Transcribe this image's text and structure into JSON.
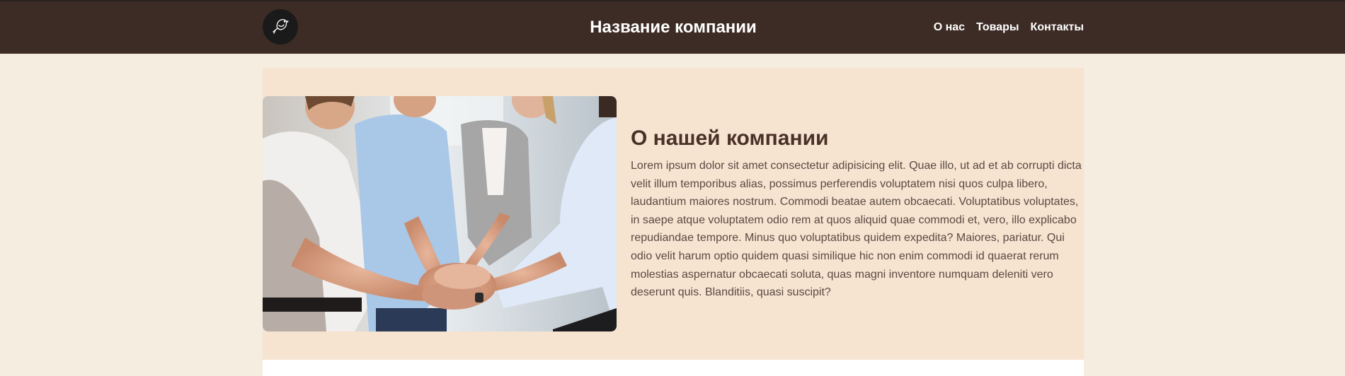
{
  "header": {
    "logo_icon": "bird-icon",
    "title": "Название компании",
    "nav": [
      {
        "label": "О нас"
      },
      {
        "label": "Товары"
      },
      {
        "label": "Контакты"
      }
    ]
  },
  "about": {
    "image_icon": "team-hands-photo",
    "title": "О нашей компании",
    "text": "Lorem ipsum dolor sit amet consectetur adipisicing elit. Quae illo, ut ad et ab corrupti dicta velit illum temporibus alias, possimus perferendis voluptatem nisi quos culpa libero, laudantium maiores nostrum. Commodi beatae autem obcaecati. Voluptatibus voluptates, in saepe atque voluptatem odio rem at quos aliquid quae commodi et, vero, illo explicabo repudiandae tempore. Minus quo voluptatibus quidem expedita? Maiores, pariatur. Qui odio velit harum optio quidem quasi similique hic non enim commodi id quaerat rerum molestias aspernatur obcaecati soluta, quas magni inventore numquam deleniti vero deserunt quis. Blanditiis, quasi suscipit?"
  },
  "colors": {
    "header_bg": "#3d2c25",
    "page_bg": "#f6ede1",
    "section_bg": "#f6e3d0",
    "title_color": "#4a3127"
  }
}
